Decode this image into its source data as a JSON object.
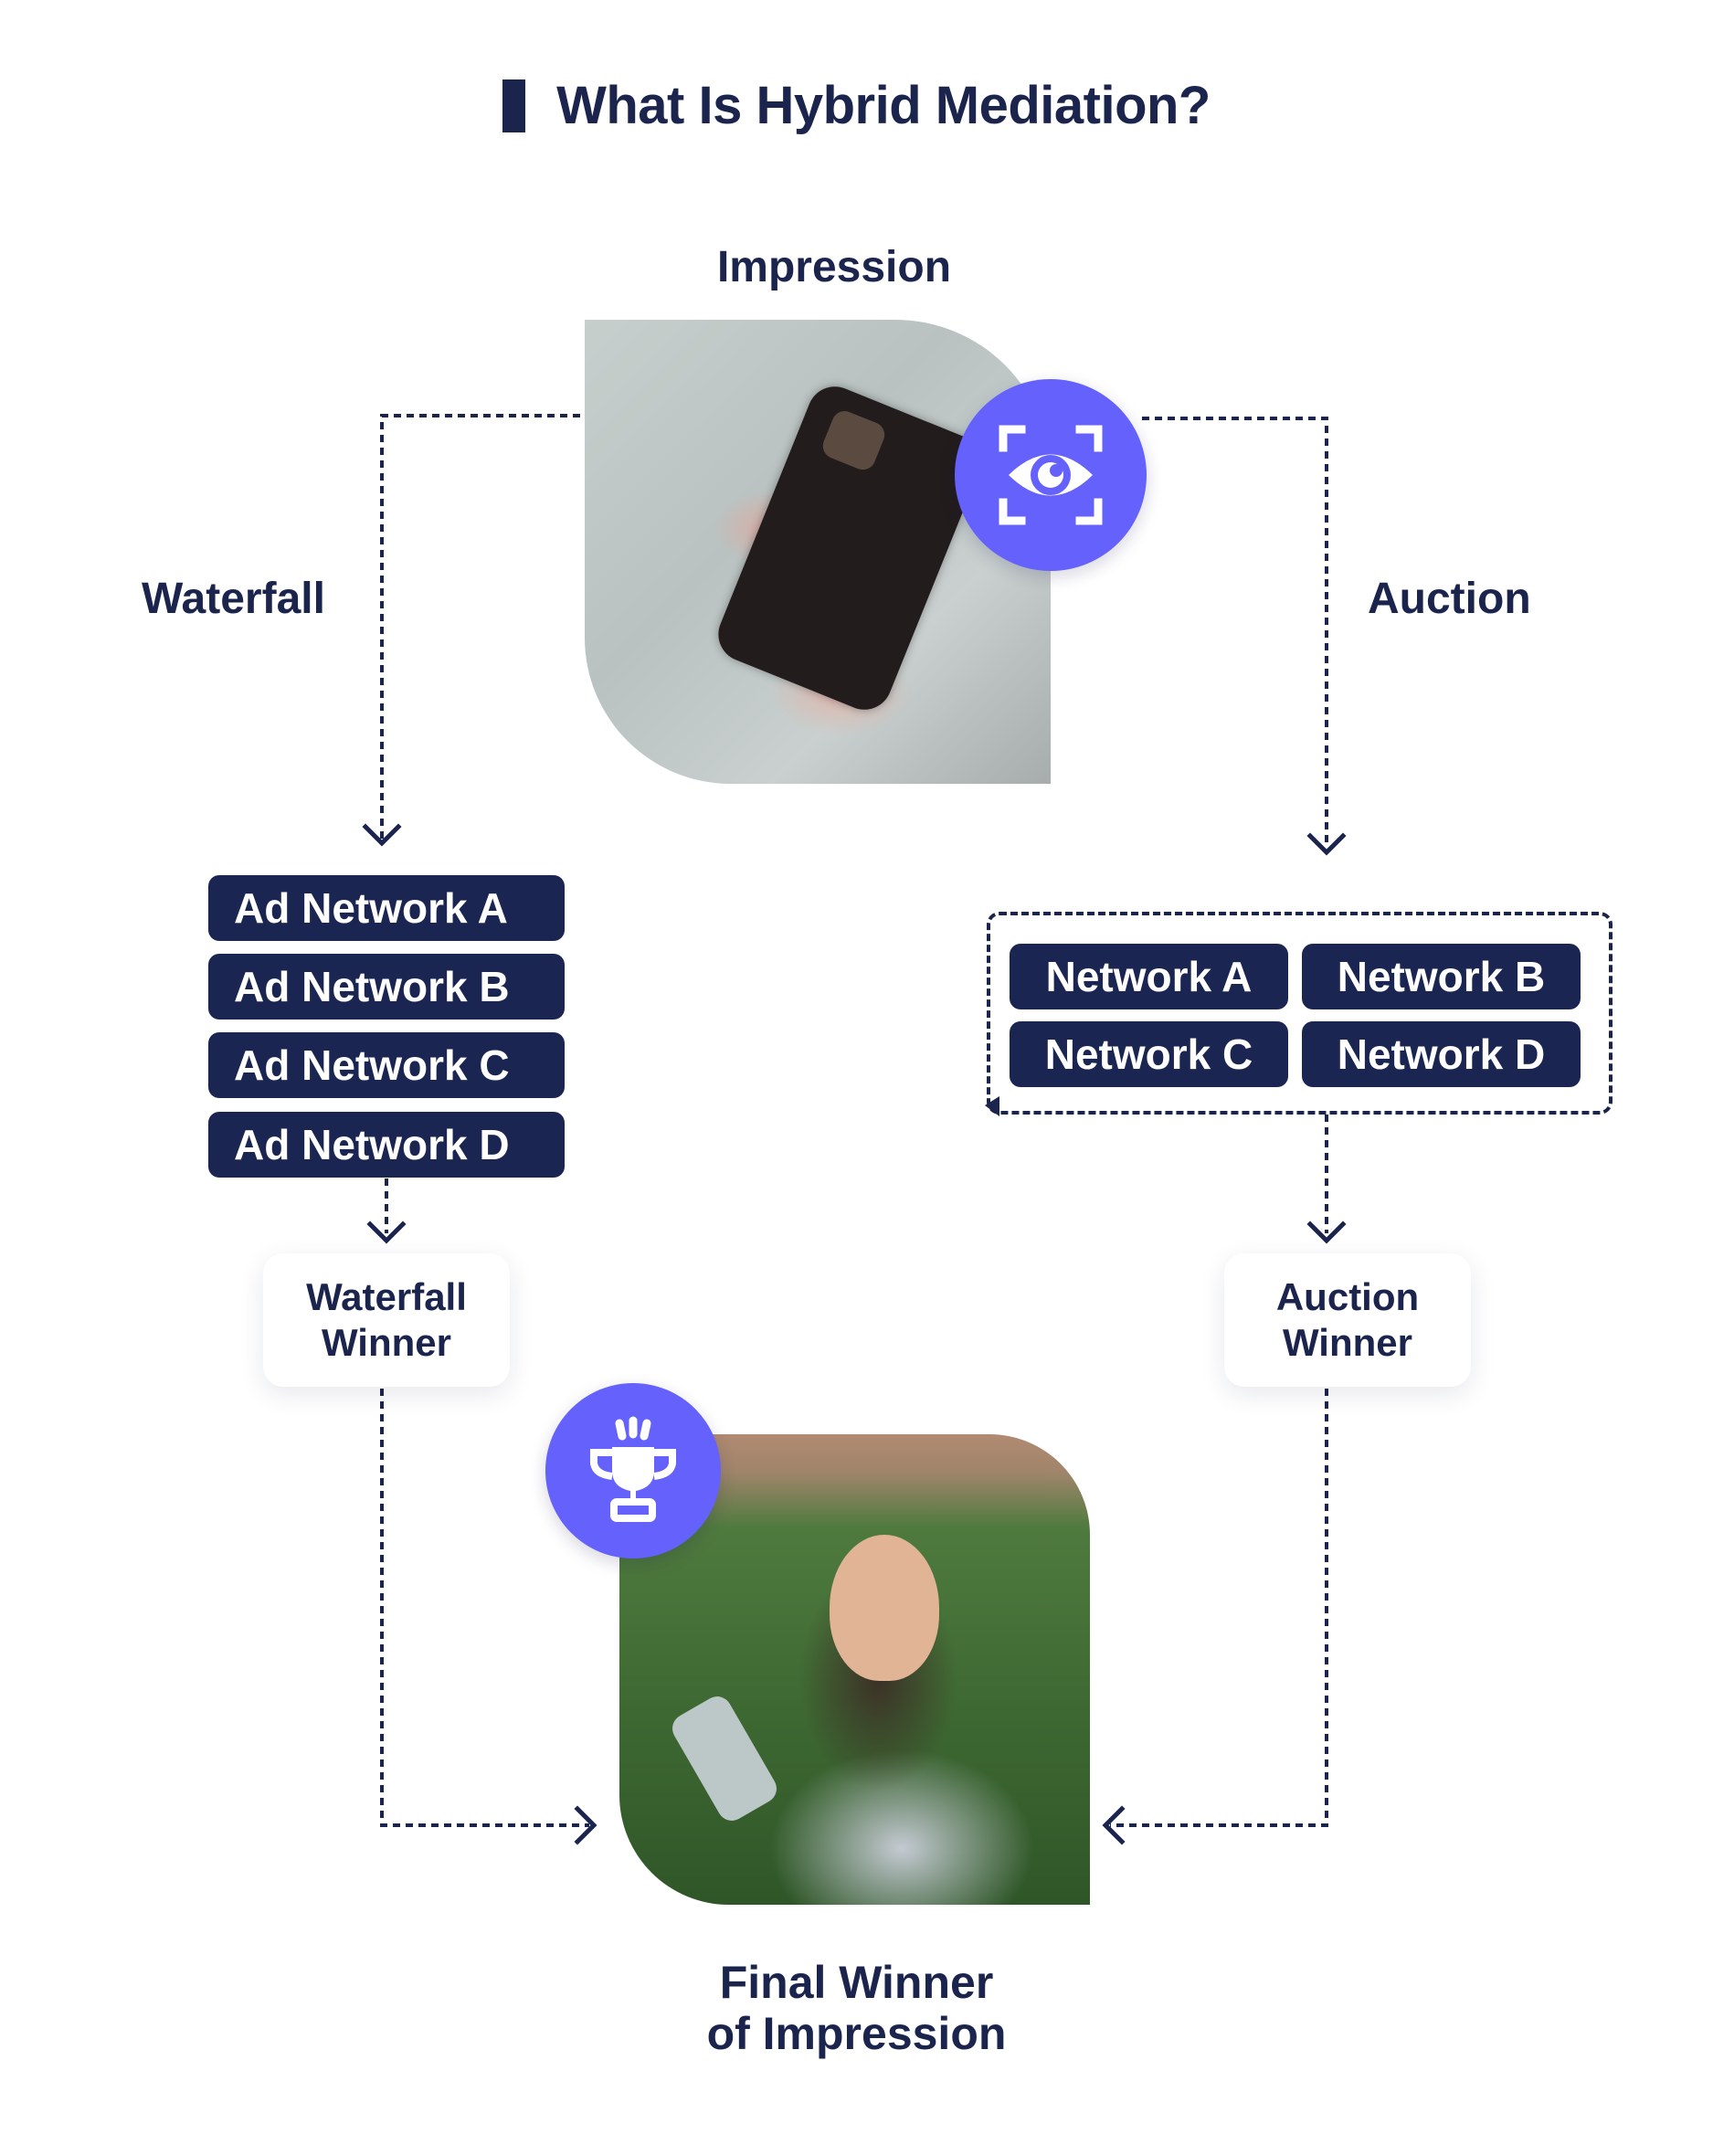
{
  "title": "What Is Hybrid Mediation?",
  "colors": {
    "navy": "#1b244d",
    "box_navy": "#1b2551",
    "accent_purple": "#6461fc",
    "card_bg": "#ffffff"
  },
  "impression": {
    "label": "Impression",
    "photo": "person holding smartphone",
    "icon": "eye-scan-icon"
  },
  "waterfall": {
    "label": "Waterfall",
    "networks": [
      "Ad Network A",
      "Ad Network B",
      "Ad Network C",
      "Ad Network D"
    ],
    "winner_line1": "Waterfall",
    "winner_line2": "Winner"
  },
  "auction": {
    "label": "Auction",
    "networks": [
      "Network A",
      "Network B",
      "Network C",
      "Network D"
    ],
    "winner_line1": "Auction",
    "winner_line2": "Winner"
  },
  "final": {
    "line1": "Final Winner",
    "line2": "of Impression",
    "photo": "woman with earphones looking at smartphone",
    "icon": "trophy-icon"
  }
}
